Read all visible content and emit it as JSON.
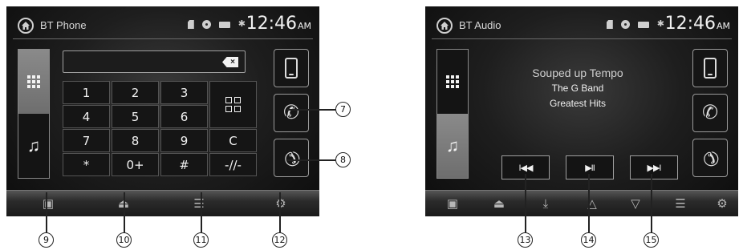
{
  "left_screen": {
    "title": "BT Phone",
    "clock": {
      "time": "12:46",
      "ampm": "AM"
    },
    "status_icons": [
      "sd-card-icon",
      "disc-icon",
      "usb-icon",
      "bluetooth-icon"
    ],
    "side_tabs": [
      {
        "icon": "keypad-grid-icon",
        "active": true
      },
      {
        "icon": "music-note-icon",
        "active": false
      }
    ],
    "entry": {
      "value": "",
      "backspace_label": "×"
    },
    "keypad": {
      "keys": [
        "1",
        "2",
        "3",
        "4",
        "5",
        "6",
        "7",
        "8",
        "9",
        "*",
        "0+",
        "#"
      ],
      "extra": [
        "contacts-grid-icon",
        "redial-icon",
        "mute-icon"
      ],
      "redial_glyph": "C",
      "mute_glyph": "-//-"
    },
    "right_buttons": [
      "phone-device-icon",
      "call-answer-icon",
      "call-end-icon"
    ],
    "bottom_bar": [
      "display-icon",
      "eject-icon",
      "equalizer-icon",
      "settings-icon"
    ]
  },
  "right_screen": {
    "title": "BT Audio",
    "clock": {
      "time": "12:46",
      "ampm": "AM"
    },
    "status_icons": [
      "sd-card-icon",
      "disc-icon",
      "usb-icon",
      "bluetooth-icon"
    ],
    "side_tabs": [
      {
        "icon": "keypad-grid-icon",
        "active": false
      },
      {
        "icon": "music-note-icon",
        "active": true
      }
    ],
    "track": {
      "title": "Souped up Tempo",
      "artist": "The G Band",
      "album": "Greatest Hits"
    },
    "transport": {
      "prev": "I◀◀",
      "play_pause": "▶II",
      "next": "▶▶I"
    },
    "right_buttons": [
      "phone-device-icon",
      "call-answer-icon",
      "call-end-icon"
    ],
    "bottom_bar": [
      "display-icon",
      "eject-icon",
      "download-icon",
      "up-arrow-icon",
      "down-arrow-icon",
      "equalizer-icon",
      "settings-icon"
    ]
  },
  "callouts": [
    "7",
    "8",
    "9",
    "10",
    "11",
    "12",
    "13",
    "14",
    "15"
  ]
}
